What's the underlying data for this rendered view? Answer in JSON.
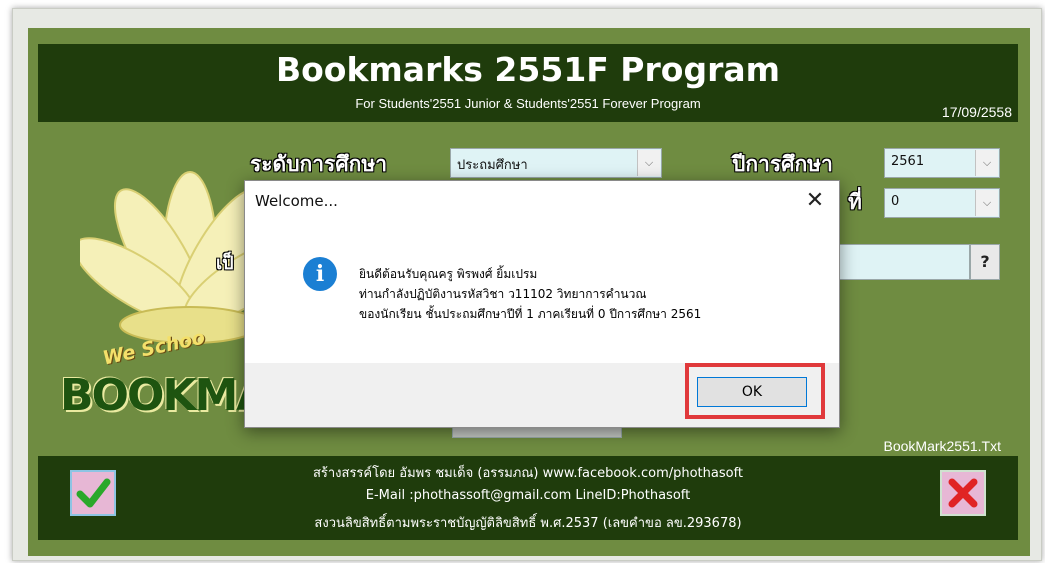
{
  "app": {
    "title": "Bookmarks 2551F Program",
    "subtitle": "For Students'2551 Junior & Students'2551 Forever Program",
    "date": "17/09/2558",
    "logo_text": "BOOKMAR",
    "logo_tagline": "We Schoo",
    "file_label": "BookMark2551.Txt"
  },
  "form": {
    "level_label": "ระดับการศึกษา",
    "level_value": "ประถมศึกษา",
    "year_label": "ปีการศึกษา",
    "year_value": "2561",
    "term_label_visible": "ที่",
    "term_value": "0",
    "partial_label": "เป็",
    "help_button": "?"
  },
  "footer": {
    "line1": "สร้างสรรค์โดย อัมพร ชมเด็จ (อรรมภณ) www.facebook.com/phothasoft",
    "line2": "E-Mail :phothassoft@gmail.com  LineID:Phothasoft",
    "line3": "สงวนลิขสิทธิ์ตามพระราชบัญญัติลิขสิทธิ์ พ.ศ.2537 (เลขคำขอ ลข.293678)"
  },
  "dialog": {
    "title": "Welcome...",
    "close": "✕",
    "icon": "info-icon",
    "line1": "ยินดีต้อนรับคุณครู พิรพงศ์  ยิ้มเปรม",
    "line2": "ท่านกำลังปฏิบัติงานรหัสวิชา ว11102  วิทยาการคำนวณ",
    "line3": "ของนักเรียน ชั้นประถมศึกษาปีที่ 1 ภาคเรียนที่ 0  ปีการศึกษา 2561",
    "ok": "OK"
  },
  "colors": {
    "accent_dark_green": "#1f3c0c",
    "app_green": "#6f8c41",
    "highlight_red": "#e0393b",
    "info_blue": "#1b7fd3"
  }
}
